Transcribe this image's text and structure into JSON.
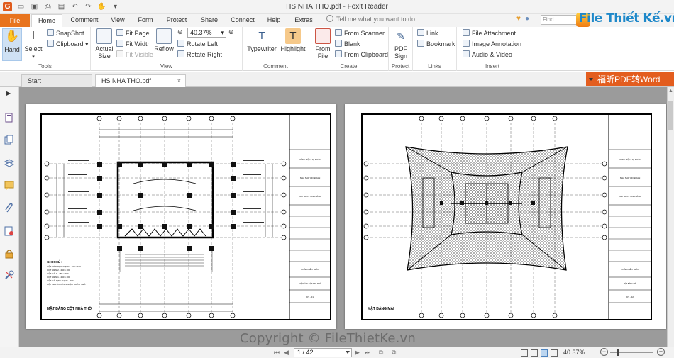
{
  "window": {
    "title": "HS NHA  THO.pdf - Foxit Reader",
    "app_logo": "G"
  },
  "menu_tabs": [
    "File",
    "Home",
    "Comment",
    "View",
    "Form",
    "Protect",
    "Share",
    "Connect",
    "Help",
    "Extras"
  ],
  "active_tab": "Home",
  "tell_me_placeholder": "Tell me what you want to do...",
  "find_placeholder": "Find",
  "watermark_logo": "File Thiết Kế.vn",
  "ribbon": {
    "tools": {
      "label": "Tools",
      "hand": "Hand",
      "select": "Select",
      "snapshot": "SnapShot",
      "clipboard": "Clipboard"
    },
    "view": {
      "label": "View",
      "actual_size_l1": "Actual",
      "actual_size_l2": "Size",
      "fit_page": "Fit Page",
      "fit_width": "Fit Width",
      "fit_visible": "Fit Visible",
      "reflow": "Reflow",
      "zoom_value": "40.37%",
      "rotate_left": "Rotate Left",
      "rotate_right": "Rotate Right"
    },
    "comment": {
      "label": "Comment",
      "typewriter": "Typewriter",
      "highlight": "Highlight"
    },
    "create": {
      "label": "Create",
      "from_file_l1": "From",
      "from_file_l2": "File",
      "from_scanner": "From Scanner",
      "blank": "Blank",
      "from_clipboard": "From Clipboard"
    },
    "protect": {
      "label": "Protect",
      "pdf_sign_l1": "PDF",
      "pdf_sign_l2": "Sign"
    },
    "links": {
      "label": "Links",
      "link": "Link",
      "bookmark": "Bookmark"
    },
    "insert": {
      "label": "Insert",
      "file_attachment": "File Attachment",
      "image_annotation": "Image Annotation",
      "audio_video": "Audio & Video"
    }
  },
  "doc_tabs": {
    "start": "Start",
    "current": "HS NHA  THO.pdf",
    "close": "×"
  },
  "promo_button": "福昕PDF转Word",
  "drawings": {
    "left_title": "MẶT BẰNG CỘT NHÀ THỜ",
    "right_title": "MẶT BẰNG MÁI",
    "left_notes": [
      "GHI CHÚ :",
      "CỘT HIÊN ĐỊNH DẠNG - 100 x 100",
      "CỘT HIÊN 2 - 260 x 200",
      "CỘT CÁI 1 - 250 x 200",
      "CỘT HIÊN 1 - 250 x 200",
      "CỘT CÁI ĐỊNH DẠNG - 200",
      "CỘT TRƯỚC CỬA & MỘI TRƯỚC NHÀ"
    ],
    "title_block": [
      "DÒNG TỘC HỌ ĐOÀN",
      "NHÀ THỜ HỌ ĐOÀN",
      "KIM SƠN - NINH BÌNH",
      "PHẦN KIẾN TRÚC"
    ],
    "left_sheet": "MẶT BẰNG CỘT NHÀ THỜ",
    "right_sheet": "MẶT BẰNG MÁI",
    "left_code": "KT - 01",
    "right_code": "KT - 02"
  },
  "copyright": "Copyright © FileThietKe.vn",
  "status": {
    "page_value": "1 / 42",
    "zoom": "40.37%"
  }
}
